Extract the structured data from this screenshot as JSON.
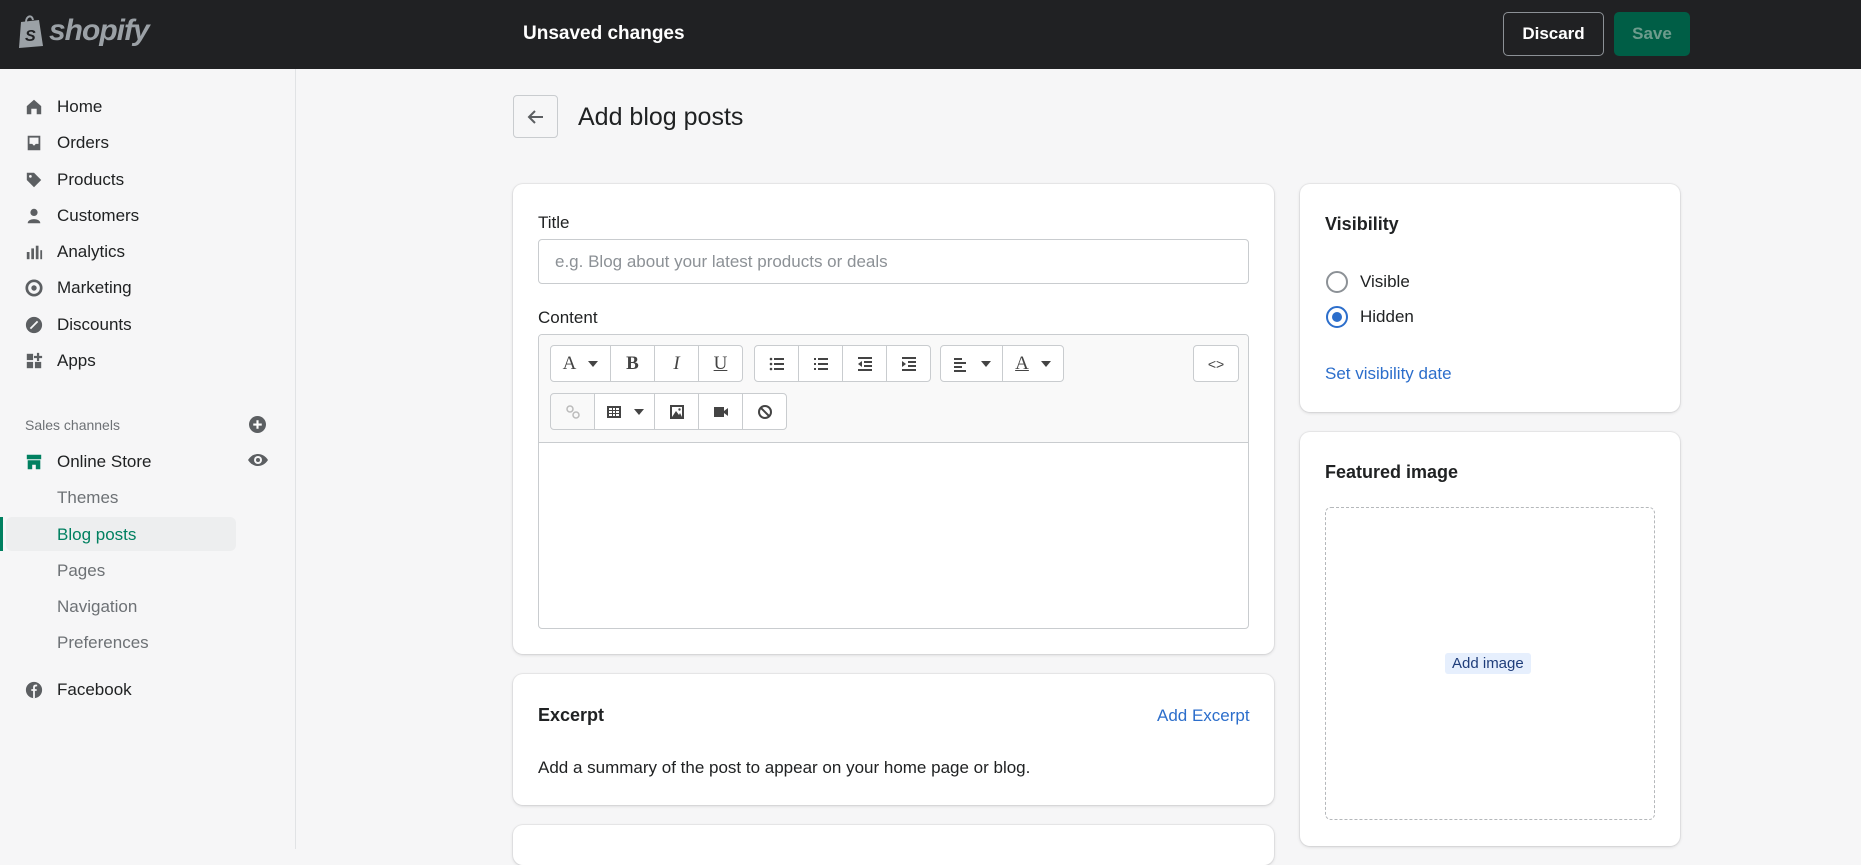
{
  "topbar": {
    "logo": "shopify",
    "status": "Unsaved changes",
    "discard": "Discard",
    "save": "Save"
  },
  "sidebar": {
    "items": [
      {
        "label": "Home",
        "icon": "home-icon"
      },
      {
        "label": "Orders",
        "icon": "inbox-icon"
      },
      {
        "label": "Products",
        "icon": "tag-icon"
      },
      {
        "label": "Customers",
        "icon": "person-icon"
      },
      {
        "label": "Analytics",
        "icon": "bar-chart-icon"
      },
      {
        "label": "Marketing",
        "icon": "target-icon"
      },
      {
        "label": "Discounts",
        "icon": "discount-icon"
      },
      {
        "label": "Apps",
        "icon": "apps-icon"
      }
    ],
    "sales_channels": "Sales channels",
    "online_store": "Online Store",
    "sub_items": [
      "Themes",
      "Blog posts",
      "Pages",
      "Navigation",
      "Preferences"
    ],
    "facebook": "Facebook",
    "accent": "#008060"
  },
  "page": {
    "title": "Add blog posts"
  },
  "main": {
    "title_label": "Title",
    "title_placeholder": "e.g. Blog about your latest products or deals",
    "title_value": "",
    "content_label": "Content",
    "toolbar": {
      "font": "A",
      "bold": "B",
      "italic": "I",
      "underline": "U",
      "color": "A",
      "code": "<>"
    },
    "excerpt": {
      "heading": "Excerpt",
      "action": "Add Excerpt",
      "description": "Add a summary of the post to appear on your home page or blog."
    }
  },
  "visibility": {
    "heading": "Visibility",
    "options": [
      "Visible",
      "Hidden"
    ],
    "selected": "Hidden",
    "link": "Set visibility date"
  },
  "featured": {
    "heading": "Featured image",
    "button": "Add image"
  }
}
